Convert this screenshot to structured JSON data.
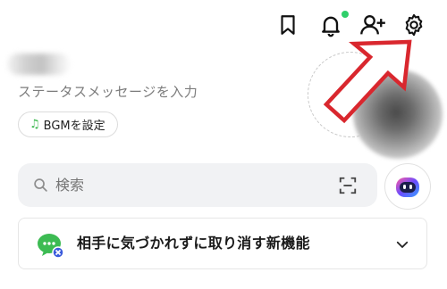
{
  "header": {
    "icons": [
      "bookmark-icon",
      "bell-icon",
      "add-friend-icon",
      "settings-gear-icon"
    ],
    "notification_dot_color": "#2fcf6a"
  },
  "profile": {
    "status_message": "ステータスメッセージを入力",
    "bgm_button_label": "BGMを設定"
  },
  "search": {
    "placeholder": "検索"
  },
  "banner": {
    "text": "相手に気づかれずに取り消す新機能"
  },
  "colors": {
    "annotation_arrow": "#d9272e",
    "bgm_note": "#38b64a",
    "search_bg": "#f1f2f4",
    "banner_icon": "#3dbb53",
    "ai_icon_gradient": [
      "#6a4cff",
      "#3aa0ff"
    ]
  }
}
